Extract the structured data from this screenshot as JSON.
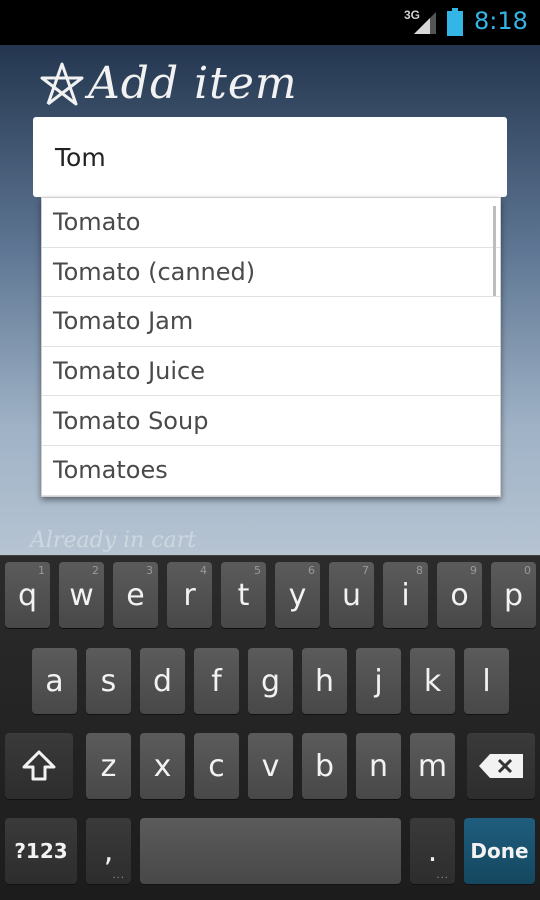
{
  "status_bar": {
    "network": "3G",
    "time": "8:18"
  },
  "colors": {
    "clock": "#33b5e5",
    "done_key": "#1f5d7e",
    "battery": "#33b5e5"
  },
  "screen": {
    "title": "Add item",
    "background_hint": "Already in cart"
  },
  "search": {
    "value": "Tom",
    "suggestions": [
      "Tomato",
      "Tomato (canned)",
      "Tomato Jam",
      "Tomato Juice",
      "Tomato Soup",
      "Tomatoes"
    ]
  },
  "keyboard": {
    "row1": [
      {
        "label": "q",
        "hint": "1"
      },
      {
        "label": "w",
        "hint": "2"
      },
      {
        "label": "e",
        "hint": "3"
      },
      {
        "label": "r",
        "hint": "4"
      },
      {
        "label": "t",
        "hint": "5"
      },
      {
        "label": "y",
        "hint": "6"
      },
      {
        "label": "u",
        "hint": "7"
      },
      {
        "label": "i",
        "hint": "8"
      },
      {
        "label": "o",
        "hint": "9"
      },
      {
        "label": "p",
        "hint": "0"
      }
    ],
    "row2": [
      "a",
      "s",
      "d",
      "f",
      "g",
      "h",
      "j",
      "k",
      "l"
    ],
    "row3": [
      "z",
      "x",
      "c",
      "v",
      "b",
      "n",
      "m"
    ],
    "symbols_label": "?123",
    "comma_label": ",",
    "period_label": ".",
    "done_label": "Done",
    "shift_icon": "shift-icon",
    "backspace_icon": "backspace-icon"
  }
}
